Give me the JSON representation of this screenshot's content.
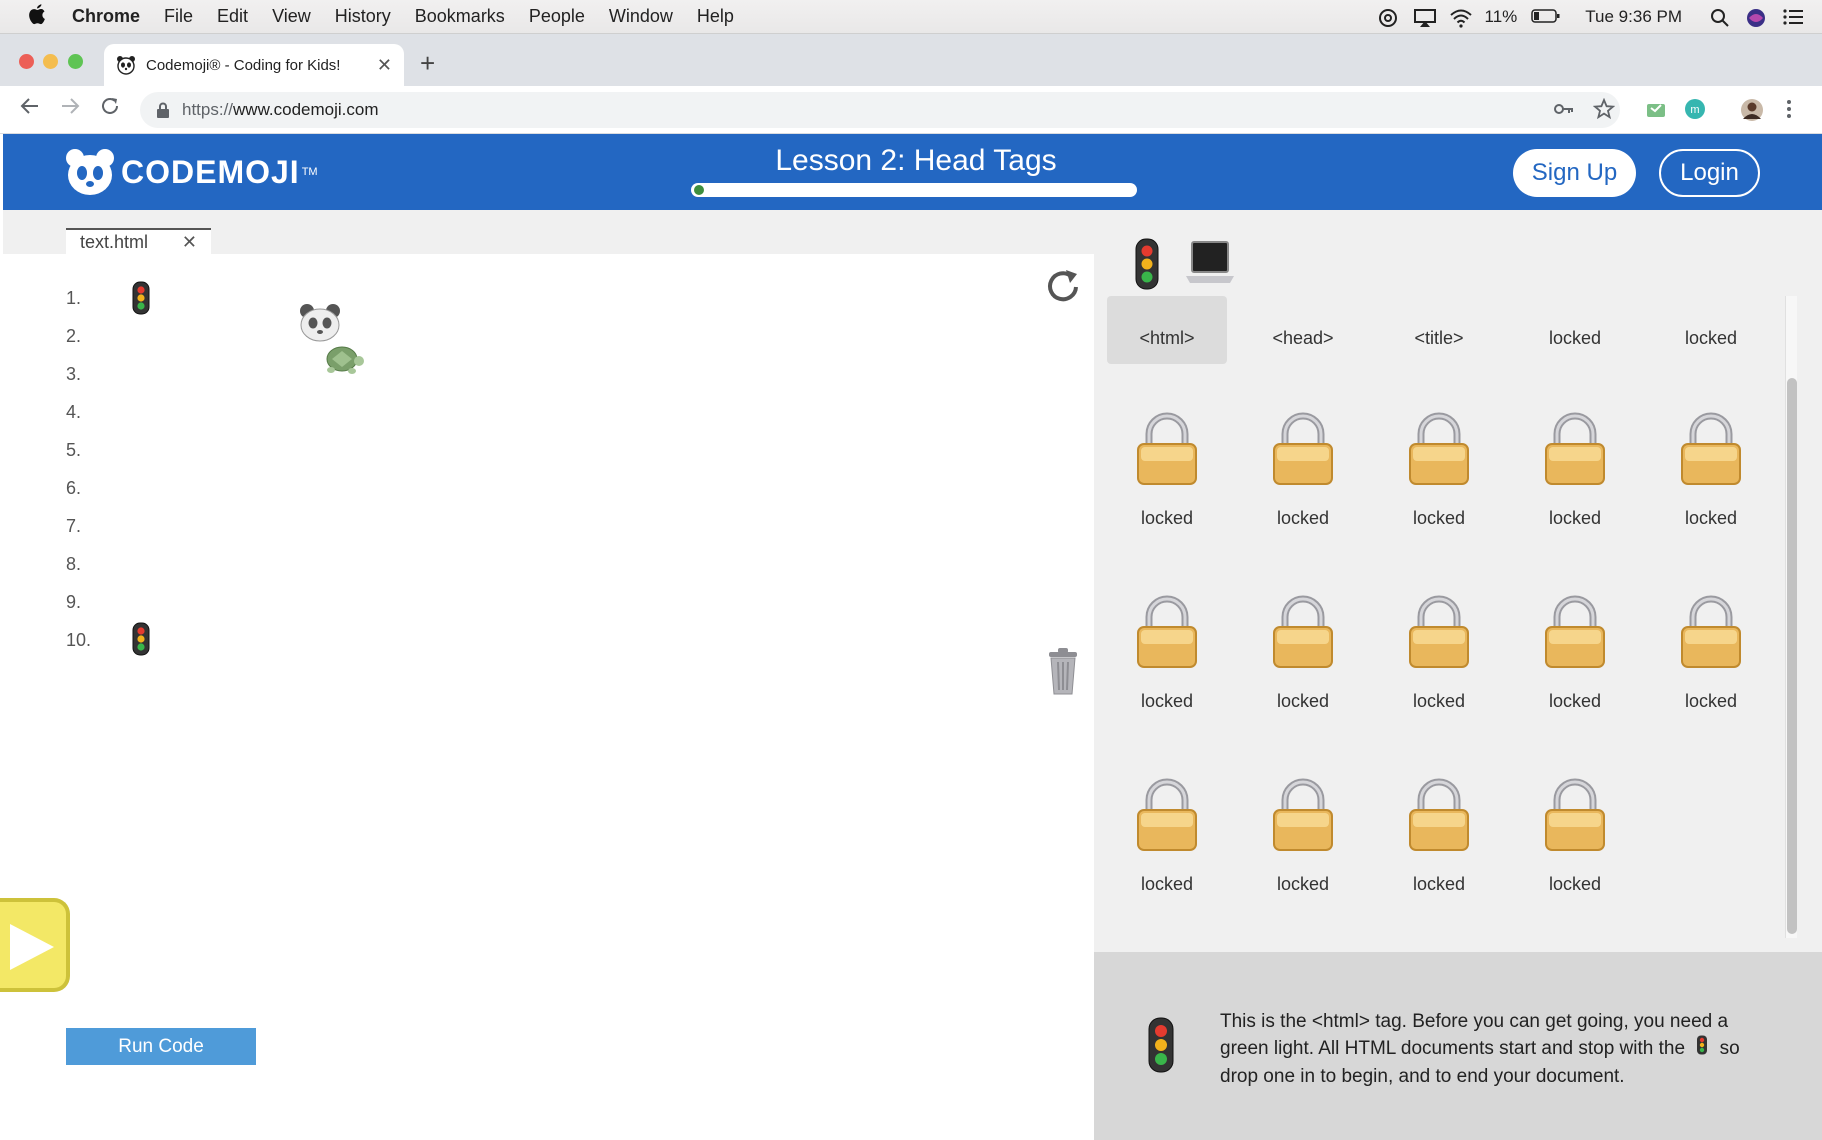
{
  "menubar": {
    "app": "Chrome",
    "items": [
      "File",
      "Edit",
      "View",
      "History",
      "Bookmarks",
      "People",
      "Window",
      "Help"
    ],
    "battery": "11%",
    "clock": "Tue 9:36 PM"
  },
  "browser": {
    "tab_title": "Codemoji® - Coding for Kids!",
    "url_scheme": "https://",
    "url_host": "www.codemoji.com"
  },
  "header": {
    "brand": "CODEMOJI",
    "trademark": "TM",
    "lesson_title": "Lesson 2: Head Tags",
    "progress_fraction": 0.02,
    "signup_label": "Sign Up",
    "login_label": "Login"
  },
  "editor": {
    "file_name": "text.html",
    "line_numbers": [
      "1.",
      "2.",
      "3.",
      "4.",
      "5.",
      "6.",
      "7.",
      "8.",
      "9.",
      "10."
    ],
    "run_label": "Run Code"
  },
  "palette": {
    "tiles": [
      {
        "label": "<html>",
        "locked": false,
        "selected": true
      },
      {
        "label": "<head>",
        "locked": false
      },
      {
        "label": "<title>",
        "locked": false
      },
      {
        "label": "locked",
        "locked": true
      },
      {
        "label": "locked",
        "locked": true
      },
      {
        "label": "locked",
        "locked": true
      },
      {
        "label": "locked",
        "locked": true
      },
      {
        "label": "locked",
        "locked": true
      },
      {
        "label": "locked",
        "locked": true
      },
      {
        "label": "locked",
        "locked": true
      },
      {
        "label": "locked",
        "locked": true
      },
      {
        "label": "locked",
        "locked": true
      },
      {
        "label": "locked",
        "locked": true
      },
      {
        "label": "locked",
        "locked": true
      },
      {
        "label": "locked",
        "locked": true
      },
      {
        "label": "locked",
        "locked": true
      },
      {
        "label": "locked",
        "locked": true
      },
      {
        "label": "locked",
        "locked": true
      },
      {
        "label": "locked",
        "locked": true
      }
    ]
  },
  "info": {
    "line1": "This is the <html> tag. Before you can get going, you need a",
    "line2a": "green light. All HTML documents start and stop with the",
    "line2b": "so",
    "line3": "drop one in to begin, and to end your document."
  }
}
